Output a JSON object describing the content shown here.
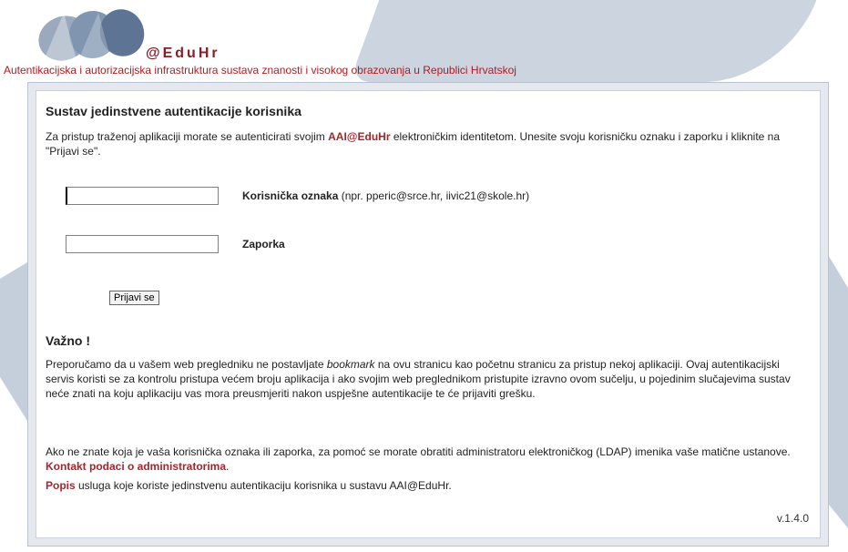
{
  "header": {
    "brand": "@EduHr",
    "tagline": "Autentikacijska i autorizacijska infrastruktura sustava znanosti i visokog obrazovanja u Republici Hrvatskoj"
  },
  "login": {
    "title": "Sustav jedinstvene autentikacije korisnika",
    "intro_prefix": "Za pristup traženoj aplikaciji morate se autenticirati svojim ",
    "intro_brand": "AAI@EduHr",
    "intro_suffix": " elektroničkim identitetom. Unesite svoju korisničku oznaku i zaporku i kliknite na \"Prijavi se\".",
    "username_label": "Korisnička oznaka",
    "username_hint": " (npr. pperic@srce.hr, iivic21@skole.hr)",
    "username_value": "",
    "password_label": "Zaporka",
    "password_value": "",
    "submit_label": "Prijavi se"
  },
  "important": {
    "heading": "Važno !",
    "text_before": "Preporučamo da u vašem web pregledniku ne postavljate ",
    "text_italic": "bookmark",
    "text_after": " na ovu stranicu kao početnu stranicu za pristup nekoj aplikaciji. Ovaj autentikacijski servis koristi se za kontrolu pristupa većem broju aplikacija i ako svojim web preglednikom pristupite izravno ovom sučelju, u pojedinim slučajevima sustav neće znati na koju aplikaciju vas mora preusmjeriti nakon uspješne autentikacije te će prijaviti grešku."
  },
  "help": {
    "text": "Ako ne znate koja je vaša korisnička oznaka ili zaporka, za pomoć se morate obratiti administratoru elektroničkog (LDAP) imenika vaše matične ustanove. ",
    "contact_link": "Kontakt podaci o administratorima",
    "after_link": ".",
    "popis_link": "Popis",
    "popis_text": " usluga koje koriste jedinstvenu autentikaciju korisnika u sustavu AAI@EduHr."
  },
  "version": "v.1.4.0",
  "colors": {
    "brand_red": "#a3262d",
    "tagline_red": "#b01c20",
    "panel_bg": "#e5e9ef",
    "logo_blue": "#7f95b0"
  }
}
